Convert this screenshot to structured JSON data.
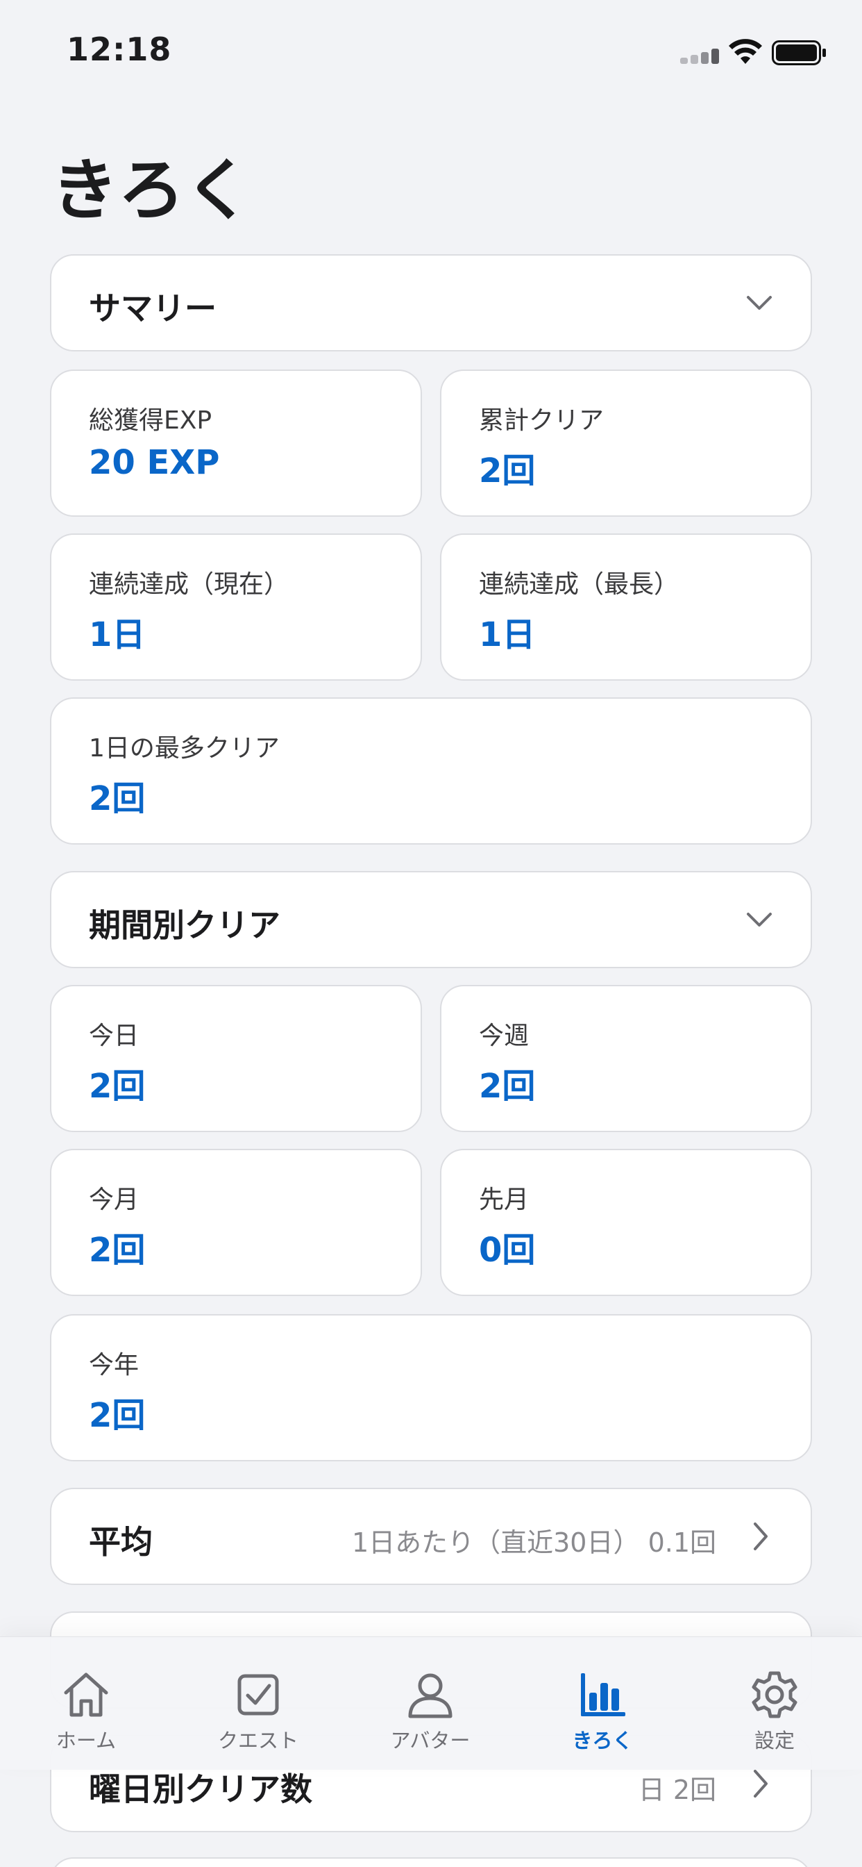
{
  "status": {
    "time": "12:18"
  },
  "page": {
    "title": "きろく"
  },
  "summary": {
    "title": "サマリー",
    "stats": [
      {
        "label": "総獲得EXP",
        "value": "20 EXP"
      },
      {
        "label": "累計クリア",
        "value": "2回"
      },
      {
        "label": "連続達成（現在）",
        "value": "1日"
      },
      {
        "label": "連続達成（最長）",
        "value": "1日"
      },
      {
        "label": "1日の最多クリア",
        "value": "2回"
      }
    ]
  },
  "period": {
    "title": "期間別クリア",
    "stats": [
      {
        "label": "今日",
        "value": "2回"
      },
      {
        "label": "今週",
        "value": "2回"
      },
      {
        "label": "今月",
        "value": "2回"
      },
      {
        "label": "先月",
        "value": "0回"
      },
      {
        "label": "今年",
        "value": "2回"
      }
    ]
  },
  "average": {
    "title": "平均",
    "value": "1日あたり（直近30日） 0.1回"
  },
  "weekday": {
    "title": "曜日別クリア数",
    "value": "日 2回"
  },
  "tabs": [
    {
      "label": "ホーム",
      "icon": "house-icon"
    },
    {
      "label": "クエスト",
      "icon": "checkbox-icon"
    },
    {
      "label": "アバター",
      "icon": "person-icon"
    },
    {
      "label": "きろく",
      "icon": "chart-icon"
    },
    {
      "label": "設定",
      "icon": "gear-icon"
    }
  ],
  "colors": {
    "accent": "#0a66c8",
    "background": "#f2f3f6"
  }
}
